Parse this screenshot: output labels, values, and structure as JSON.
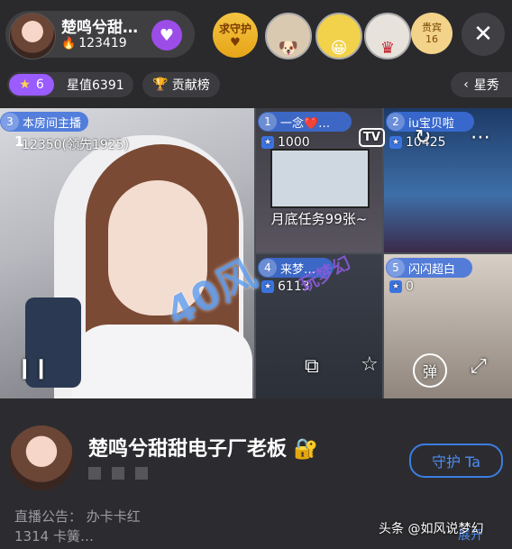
{
  "header": {
    "host_name": "楚鸣兮甜…",
    "host_heat": "123419",
    "guard_label": "求守护",
    "viewers": [
      {
        "icon": "dog-icon"
      },
      {
        "icon": "emoji-icon"
      },
      {
        "icon": "red-dress-icon"
      }
    ],
    "vip_label": "贵宾",
    "vip_count": "16"
  },
  "subbar": {
    "level": "6",
    "star_value": "星值6391",
    "contribution": "贡献榜",
    "show": "星秀"
  },
  "video": {
    "main": {
      "slot": "3",
      "label": "本房间主播",
      "stat": "12350(领先1925)",
      "corner_num": "1"
    },
    "slots": [
      {
        "slot": "1",
        "label": "一念❤️…",
        "stat": "1000",
        "banner": "月底任务99张~"
      },
      {
        "slot": "2",
        "label": "iu宝贝啦",
        "stat": "10425"
      },
      {
        "slot": "4",
        "label": "来梦…",
        "stat": "6113"
      },
      {
        "slot": "5",
        "label": "闪闪超白",
        "stat": "0"
      }
    ],
    "tv_label": "TV",
    "danmu_label": "弹",
    "watermark": "40风",
    "watermark_sub": "玩梦幻"
  },
  "footer": {
    "title": "楚鸣兮甜甜电子厂老板",
    "guard_ta": "守护 Ta",
    "notice_line1": "直播公告：  办卡卡红",
    "notice_line2": "1314 卡簧…",
    "expand": "展开",
    "credit": "头条 @如风说梦幻"
  }
}
